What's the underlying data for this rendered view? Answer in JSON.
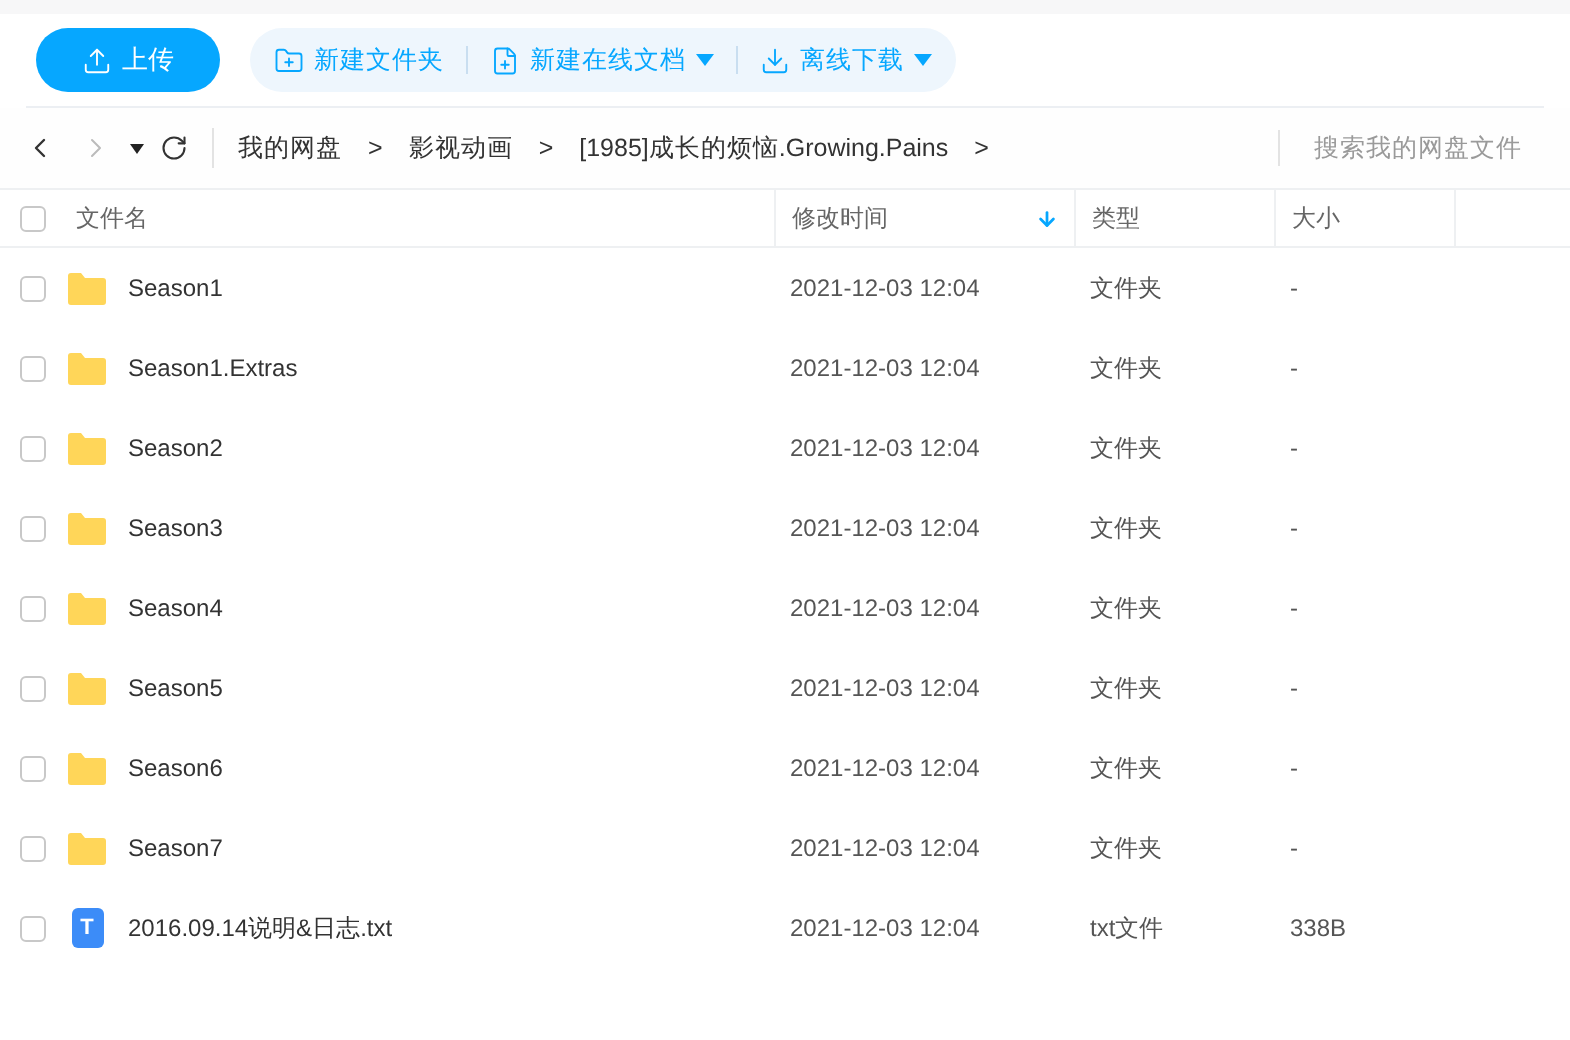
{
  "toolbar": {
    "upload": "上传",
    "actions": [
      {
        "kind": "new-folder",
        "label": "新建文件夹",
        "dropdown": false
      },
      {
        "kind": "new-doc",
        "label": "新建在线文档",
        "dropdown": true
      },
      {
        "kind": "download",
        "label": "离线下载",
        "dropdown": true
      }
    ]
  },
  "breadcrumb": {
    "items": [
      "我的网盘",
      "影视动画",
      "[1985]成长的烦恼.Growing.Pains"
    ],
    "separator": ">"
  },
  "search": {
    "placeholder": "搜索我的网盘文件"
  },
  "table": {
    "select_all_checked": false,
    "columns": [
      {
        "label": "文件名",
        "sorted": false
      },
      {
        "label": "修改时间",
        "sorted": true
      },
      {
        "label": "类型",
        "sorted": false
      },
      {
        "label": "大小",
        "sorted": false
      }
    ],
    "rows": [
      {
        "kind": "folder",
        "name": "Season1",
        "modified": "2021-12-03 12:04",
        "type": "文件夹",
        "size": "-",
        "checked": false
      },
      {
        "kind": "folder",
        "name": "Season1.Extras",
        "modified": "2021-12-03 12:04",
        "type": "文件夹",
        "size": "-",
        "checked": false
      },
      {
        "kind": "folder",
        "name": "Season2",
        "modified": "2021-12-03 12:04",
        "type": "文件夹",
        "size": "-",
        "checked": false
      },
      {
        "kind": "folder",
        "name": "Season3",
        "modified": "2021-12-03 12:04",
        "type": "文件夹",
        "size": "-",
        "checked": false
      },
      {
        "kind": "folder",
        "name": "Season4",
        "modified": "2021-12-03 12:04",
        "type": "文件夹",
        "size": "-",
        "checked": false
      },
      {
        "kind": "folder",
        "name": "Season5",
        "modified": "2021-12-03 12:04",
        "type": "文件夹",
        "size": "-",
        "checked": false
      },
      {
        "kind": "folder",
        "name": "Season6",
        "modified": "2021-12-03 12:04",
        "type": "文件夹",
        "size": "-",
        "checked": false
      },
      {
        "kind": "folder",
        "name": "Season7",
        "modified": "2021-12-03 12:04",
        "type": "文件夹",
        "size": "-",
        "checked": false
      },
      {
        "kind": "text-file",
        "icon_letter": "T",
        "name": "2016.09.14说明&日志.txt",
        "modified": "2021-12-03 12:04",
        "type": "txt文件",
        "size": "338B",
        "checked": false
      }
    ]
  }
}
